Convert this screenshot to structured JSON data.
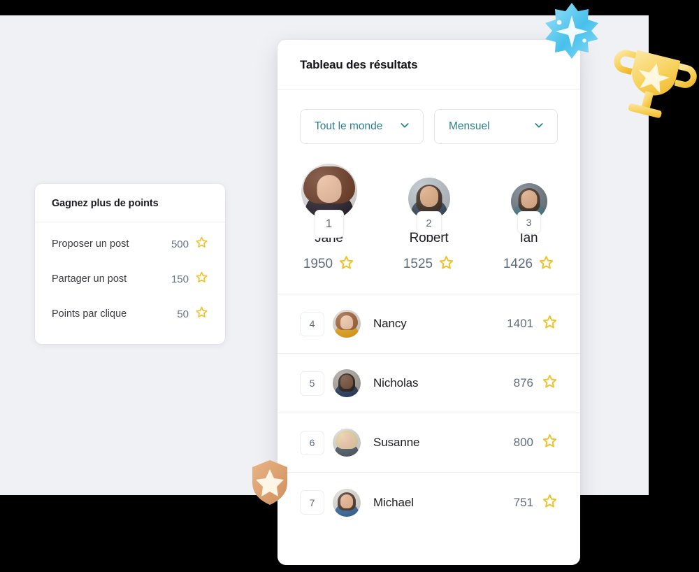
{
  "theme": {
    "page_background": "#000000",
    "backdrop": "#f0f1f5",
    "card_background": "#ffffff",
    "accent_teal": "#2b7f8d",
    "star_gold": "#f0c22c",
    "text_primary": "#1d1d22",
    "text_muted": "#5f6b7d",
    "divider": "#edeef2"
  },
  "points_card": {
    "title": "Gagnez plus de points",
    "rows": [
      {
        "label": "Proposer un post",
        "value": "500",
        "icon": "star-icon"
      },
      {
        "label": "Partager un post",
        "value": "150",
        "icon": "star-icon"
      },
      {
        "label": "Points par clique",
        "value": "50",
        "icon": "star-icon"
      }
    ]
  },
  "leaderboard": {
    "title": "Tableau des résultats",
    "filters": [
      {
        "label": "Tout le monde",
        "icon": "chevron-down-icon"
      },
      {
        "label": "Mensuel",
        "icon": "chevron-down-icon"
      }
    ],
    "podium": [
      {
        "rank": "1",
        "name": "Jane",
        "score": "1950",
        "icon": "star-icon",
        "avatar": "avatar-jane"
      },
      {
        "rank": "2",
        "name": "Robert",
        "score": "1525",
        "icon": "star-icon",
        "avatar": "avatar-robert"
      },
      {
        "rank": "3",
        "name": "Ian",
        "score": "1426",
        "icon": "star-icon",
        "avatar": "avatar-ian"
      }
    ],
    "rows": [
      {
        "rank": "4",
        "name": "Nancy",
        "score": "1401",
        "icon": "star-icon",
        "avatar": "avatar-nancy"
      },
      {
        "rank": "5",
        "name": "Nicholas",
        "score": "876",
        "icon": "star-icon",
        "avatar": "avatar-nicholas"
      },
      {
        "rank": "6",
        "name": "Susanne",
        "score": "800",
        "icon": "star-icon",
        "avatar": "avatar-susanne"
      },
      {
        "rank": "7",
        "name": "Michael",
        "score": "751",
        "icon": "star-icon",
        "avatar": "avatar-michael"
      }
    ]
  },
  "decorations": [
    {
      "name": "sparkle-star-badge",
      "color": "#4ec3ee"
    },
    {
      "name": "trophy-badge",
      "color": "#f5cf5e"
    },
    {
      "name": "shield-star-badge",
      "color": "#e0a877"
    }
  ]
}
